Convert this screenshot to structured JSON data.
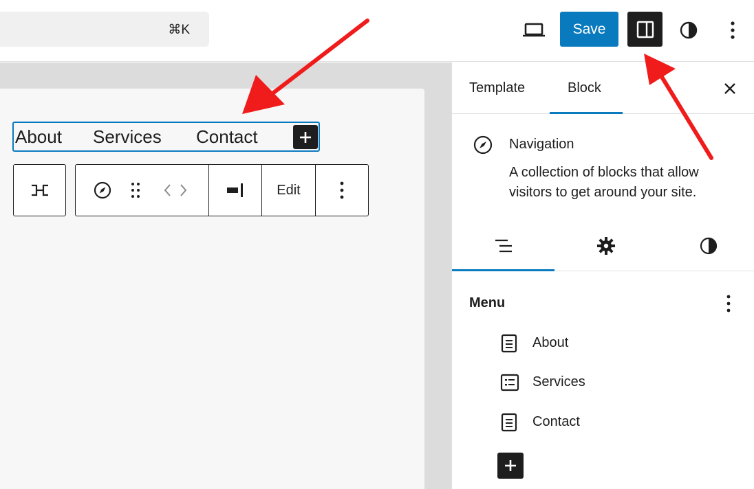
{
  "topbar": {
    "command_shortcut": "⌘K",
    "save_label": "Save"
  },
  "canvas": {
    "nav_links": [
      "About",
      "Services",
      "Contact"
    ],
    "toolbar": {
      "edit_label": "Edit"
    }
  },
  "sidebar": {
    "tabs": [
      {
        "label": "Template",
        "active": false
      },
      {
        "label": "Block",
        "active": true
      }
    ],
    "block": {
      "title": "Navigation",
      "description": "A collection of blocks that allow visitors to get around your site."
    },
    "menu": {
      "heading": "Menu",
      "items": [
        {
          "label": "About",
          "icon": "page-icon"
        },
        {
          "label": "Services",
          "icon": "list-page-icon"
        },
        {
          "label": "Contact",
          "icon": "page-icon"
        }
      ]
    }
  },
  "colors": {
    "accent": "#0a7abf",
    "dark": "#1e1e1e",
    "annotation_arrow": "#f01c1c"
  }
}
